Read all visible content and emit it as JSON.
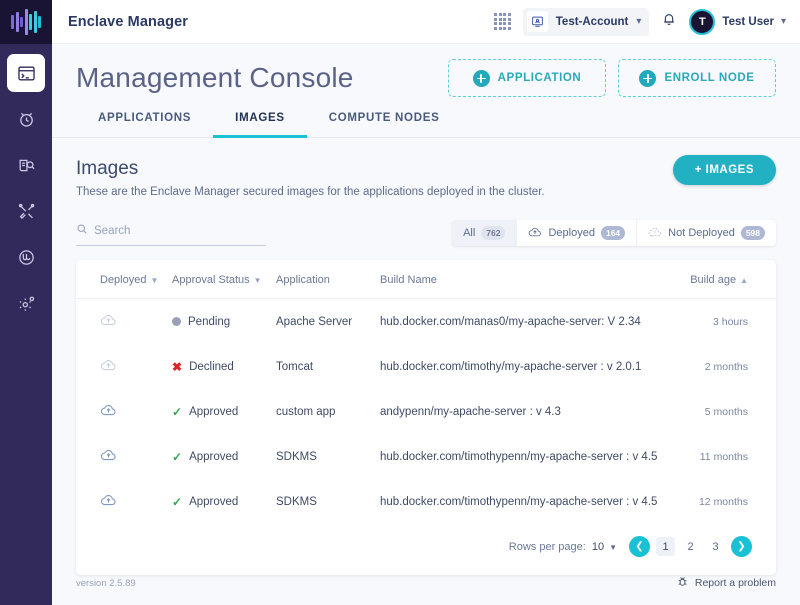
{
  "app": {
    "brand": "Enclave Manager",
    "logo_colors": [
      "#7c6bd6",
      "#8f7fe0",
      "#6f5fd0",
      "#9a8ae8",
      "#2fd3d6",
      "#3fc9e0",
      "#29b9d8"
    ]
  },
  "sidebar": {
    "items": [
      {
        "icon": "console-icon",
        "label": "Console",
        "active": true
      },
      {
        "icon": "alarm-clock-icon",
        "label": "Alerts",
        "active": false
      },
      {
        "icon": "audit-log-icon",
        "label": "Audit Log",
        "active": false
      },
      {
        "icon": "tools-icon",
        "label": "Tools",
        "active": false
      },
      {
        "icon": "user-circle-icon",
        "label": "Accounts",
        "active": false
      },
      {
        "icon": "settings-gear-icon",
        "label": "Settings",
        "active": false
      }
    ]
  },
  "topbar": {
    "account": {
      "label": "Test-Account",
      "icon": "account-tile-icon",
      "caret": "⌄"
    },
    "apps_grid_icon": "app-grid-icon",
    "notifications_icon": "bell-icon",
    "user": {
      "initial": "T",
      "name": "Test User",
      "caret": "⌄"
    }
  },
  "page": {
    "title": "Management Console",
    "actions": [
      {
        "label": "APPLICATION",
        "icon": "plus-circle-icon"
      },
      {
        "label": "ENROLL NODE",
        "icon": "plus-circle-icon"
      }
    ],
    "tabs": [
      {
        "label": "APPLICATIONS",
        "active": false
      },
      {
        "label": "IMAGES",
        "active": true
      },
      {
        "label": "COMPUTE NODES",
        "active": false
      }
    ]
  },
  "section": {
    "title": "Images",
    "subtitle": "These are the Enclave Manager secured images for the applications deployed in the cluster.",
    "primary_button": "+ IMAGES"
  },
  "search": {
    "placeholder": "Search",
    "value": "",
    "icon": "search-icon"
  },
  "filters": [
    {
      "label": "All",
      "count": "762",
      "icon": "",
      "active": true
    },
    {
      "label": "Deployed",
      "count": "164",
      "icon": "cloud-upload-icon",
      "active": false
    },
    {
      "label": "Not Deployed",
      "count": "598",
      "icon": "cloud-dashed-icon",
      "active": false
    }
  ],
  "table": {
    "columns": [
      {
        "label": "Deployed",
        "sortable": true,
        "sort": ""
      },
      {
        "label": "Approval Status",
        "sortable": true,
        "sort": ""
      },
      {
        "label": "Application",
        "sortable": false,
        "sort": ""
      },
      {
        "label": "Build Name",
        "sortable": false,
        "sort": ""
      },
      {
        "label": "Build age",
        "sortable": true,
        "sort": "asc"
      }
    ],
    "rows": [
      {
        "deployed": false,
        "deployed_icon": "cloud-upload-outline-icon",
        "status": "Pending",
        "status_type": "pending",
        "application": "Apache Server",
        "build_name": "hub.docker.com/manas0/my-apache-server: V 2.34",
        "build_age": "3 hours"
      },
      {
        "deployed": false,
        "deployed_icon": "cloud-upload-outline-icon",
        "status": "Declined",
        "status_type": "declined",
        "application": "Tomcat",
        "build_name": "hub.docker.com/timothy/my-apache-server : v 2.0.1",
        "build_age": "2 months"
      },
      {
        "deployed": true,
        "deployed_icon": "cloud-upload-icon",
        "status": "Approved",
        "status_type": "approved",
        "application": "custom app",
        "build_name": "andypenn/my-apache-server : v 4.3",
        "build_age": "5 months"
      },
      {
        "deployed": true,
        "deployed_icon": "cloud-upload-icon",
        "status": "Approved",
        "status_type": "approved",
        "application": "SDKMS",
        "build_name": "hub.docker.com/timothypenn/my-apache-server : v 4.5",
        "build_age": "11 months"
      },
      {
        "deployed": true,
        "deployed_icon": "cloud-upload-icon",
        "status": "Approved",
        "status_type": "approved",
        "application": "SDKMS",
        "build_name": "hub.docker.com/timothypenn/my-apache-server : v 4.5",
        "build_age": "12 months"
      }
    ]
  },
  "pagination": {
    "rows_per_page_label": "Rows per page:",
    "rows_per_page_value": "10",
    "prev_icon": "chevron-left-icon",
    "next_icon": "chevron-right-icon",
    "pages": [
      "1",
      "2",
      "3"
    ],
    "current_page": "1"
  },
  "footer": {
    "version": "version 2.5.89",
    "report_label": "Report a problem",
    "report_icon": "bug-icon"
  },
  "colors": {
    "accent_teal": "#19c1d4",
    "sidebar": "#332a5c",
    "logo_bg": "#191433",
    "approved_green": "#34a853",
    "declined_red": "#e02424",
    "pending_gray": "#9aa1b4"
  }
}
